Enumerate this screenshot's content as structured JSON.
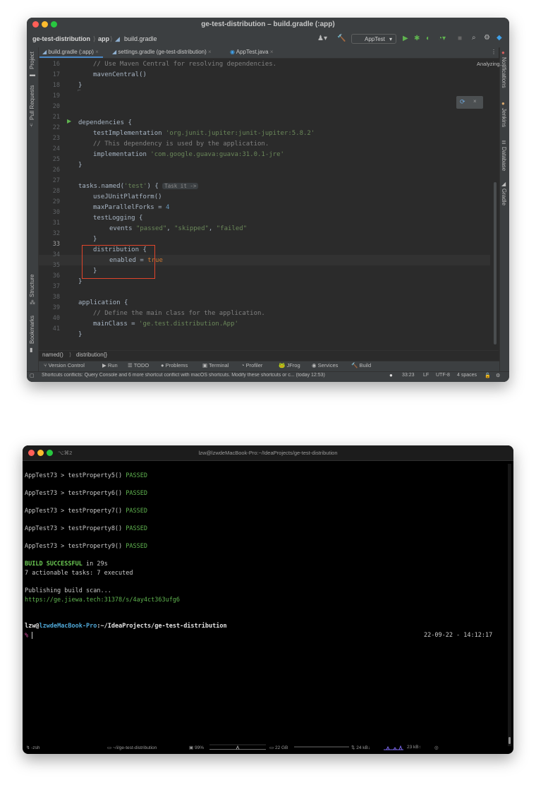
{
  "ide": {
    "window_title": "ge-test-distribution – build.gradle (:app)",
    "breadcrumbs": [
      "ge-test-distribution",
      "app",
      "build.gradle"
    ],
    "run_config": "AppTest",
    "left_tools": [
      "Project",
      "Pull Requests",
      "Structure",
      "Bookmarks"
    ],
    "right_tools": [
      "Notifications",
      "Jenkins",
      "Database",
      "Gradle"
    ],
    "tabs": [
      "build.gradle (:app)",
      "settings.gradle (ge-test-distribution)",
      "AppTest.java"
    ],
    "status_analyzing": "Analyzing...",
    "gutter": [
      "16",
      "17",
      "18",
      "19",
      "20",
      "21",
      "22",
      "23",
      "24",
      "25",
      "26",
      "27",
      "28",
      "29",
      "30",
      "31",
      "32",
      "33",
      "34",
      "35",
      "36",
      "37",
      "38",
      "39",
      "40",
      "41"
    ],
    "code": {
      "l16": "// Use Maven Central for resolving dependencies.",
      "l17": "mavenCentral()",
      "l18": "}",
      "l20": "dependencies {",
      "l21_a": "testImplementation ",
      "l21_b": "'org.junit.jupiter:junit-jupiter:5.8.2'",
      "l22": "// This dependency is used by the application.",
      "l23_a": "implementation ",
      "l23_b": "'com.google.guava:guava:31.0.1-jre'",
      "l24": "}",
      "l26_a": "tasks.named(",
      "l26_b": "'test'",
      "l26_c": ") {",
      "l26_hint": "Task it ->",
      "l27": "useJUnitPlatform()",
      "l28_a": "maxParallelForks = ",
      "l28_b": "4",
      "l29": "testLogging {",
      "l30_a": "events ",
      "l30_b": "\"passed\"",
      "l30_c": ", ",
      "l30_d": "\"skipped\"",
      "l30_e": ", ",
      "l30_f": "\"failed\"",
      "l31": "}",
      "l32": "distribution {",
      "l33_a": "enabled = ",
      "l33_b": "true",
      "l34": "}",
      "l35": "}",
      "l37": "application {",
      "l38": "// Define the main class for the application.",
      "l39_a": "mainClass = ",
      "l39_b": "'ge.test.distribution.App'",
      "l40": "}"
    },
    "code_breadcrumb": [
      "named()",
      "distribution{}"
    ],
    "bottom_tools": [
      "Version Control",
      "Run",
      "TODO",
      "Problems",
      "Terminal",
      "Profiler",
      "JFrog",
      "Services",
      "Build"
    ],
    "status_message": "Shortcuts conflicts: Query Console and 6 more shortcut conflict with macOS shortcuts. Modify these shortcuts or c... (today 12:53)",
    "status_position": "33:23",
    "status_line_sep": "LF",
    "status_encoding": "UTF-8",
    "status_indent": "4 spaces",
    "highlight_color": "#e0452b"
  },
  "terminal": {
    "tab_shortcut": "⌥⌘2",
    "window_title": "lzw@lzwdeMacBook-Pro:~/IdeaProjects/ge-test-distribution",
    "tests": [
      {
        "name": "AppTest73 > testProperty5()",
        "status": "PASSED"
      },
      {
        "name": "AppTest73 > testProperty6()",
        "status": "PASSED"
      },
      {
        "name": "AppTest73 > testProperty7()",
        "status": "PASSED"
      },
      {
        "name": "AppTest73 > testProperty8()",
        "status": "PASSED"
      },
      {
        "name": "AppTest73 > testProperty9()",
        "status": "PASSED"
      }
    ],
    "build_result": "BUILD SUCCESSFUL",
    "build_time": " in 29s",
    "tasks_line": "7 actionable tasks: 7 executed",
    "publishing": "Publishing build scan...",
    "scan_url": "https://ge.jiewa.tech:31378/s/4ay4ct363ufg6",
    "prompt_user": "lzw",
    "prompt_at": "@",
    "prompt_host": "lzwdeMacBook-Pro",
    "prompt_path": ":~/IdeaProjects/ge-test-distribution",
    "prompt_symbol": "%",
    "timestamp": "22-09-22 - 14:12:17",
    "status": {
      "shell": "-zsh",
      "dir": "~/i/ge-test-distribution",
      "cpu": "99%",
      "disk": "22 GB",
      "net_down": "24 kB↓",
      "net_up": "23 kB↑"
    }
  }
}
